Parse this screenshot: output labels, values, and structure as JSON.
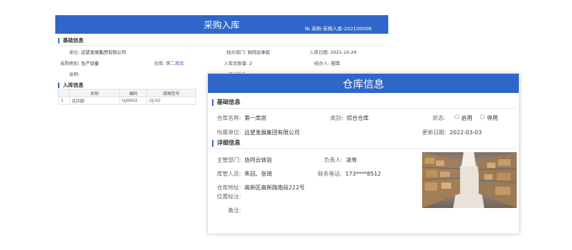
{
  "back": {
    "title": "采购入库",
    "number": "№  采购-采购入库-202100008",
    "section_basic": "基础信息",
    "unit_label": "单位:",
    "unit_value": "远望发展集团有限公司",
    "dept_label": "经办部门:",
    "dept_value": "协同云体验",
    "date_label": "入库日期:",
    "date_value": "2021-10-29",
    "cat_label": "采购类别:",
    "cat_value": "生产设备",
    "wh_label": "仓库:",
    "wh_value": "第二库房",
    "qty_label": "入库总数量:",
    "qty_value": "2",
    "handler_label": "经办人:",
    "handler_value": "苑琪",
    "note_label": "说明:",
    "attach_label": "相关附件:",
    "section_items": "入库信息",
    "table": {
      "headers": [
        "",
        "名称",
        "编码",
        "规格型号"
      ],
      "rows": [
        [
          "1",
          "花压脚",
          "GJ0003",
          "GJ-50"
        ]
      ]
    }
  },
  "front": {
    "title": "仓库信息",
    "section_basic": "基础信息",
    "name_label": "仓库名称:",
    "name_value": "第一库房",
    "type_label": "类别:",
    "type_value": "综合仓库",
    "status_label": "状态:",
    "status_on": "启用",
    "status_off": "停用",
    "org_label": "所属单位:",
    "org_value": "远望发展集团有限公司",
    "update_label": "更新日期:",
    "update_value": "2022-03-03",
    "section_detail": "详细信息",
    "dept_label": "主管部门:",
    "dept_value": "协同云体验",
    "owner_label": "负责人:",
    "owner_value": "凌寿",
    "keeper_label": "库管人员:",
    "keeper_value": "朱冠、张琦",
    "phone_label": "联系电话:",
    "phone_value": "173****8512",
    "addr_label": "仓库地址:",
    "addr_value": "高新区高新路南段222号",
    "pos_label": "位置标注:",
    "remark_label": "备注:"
  },
  "colors": {
    "accent": "#2f66c9"
  }
}
